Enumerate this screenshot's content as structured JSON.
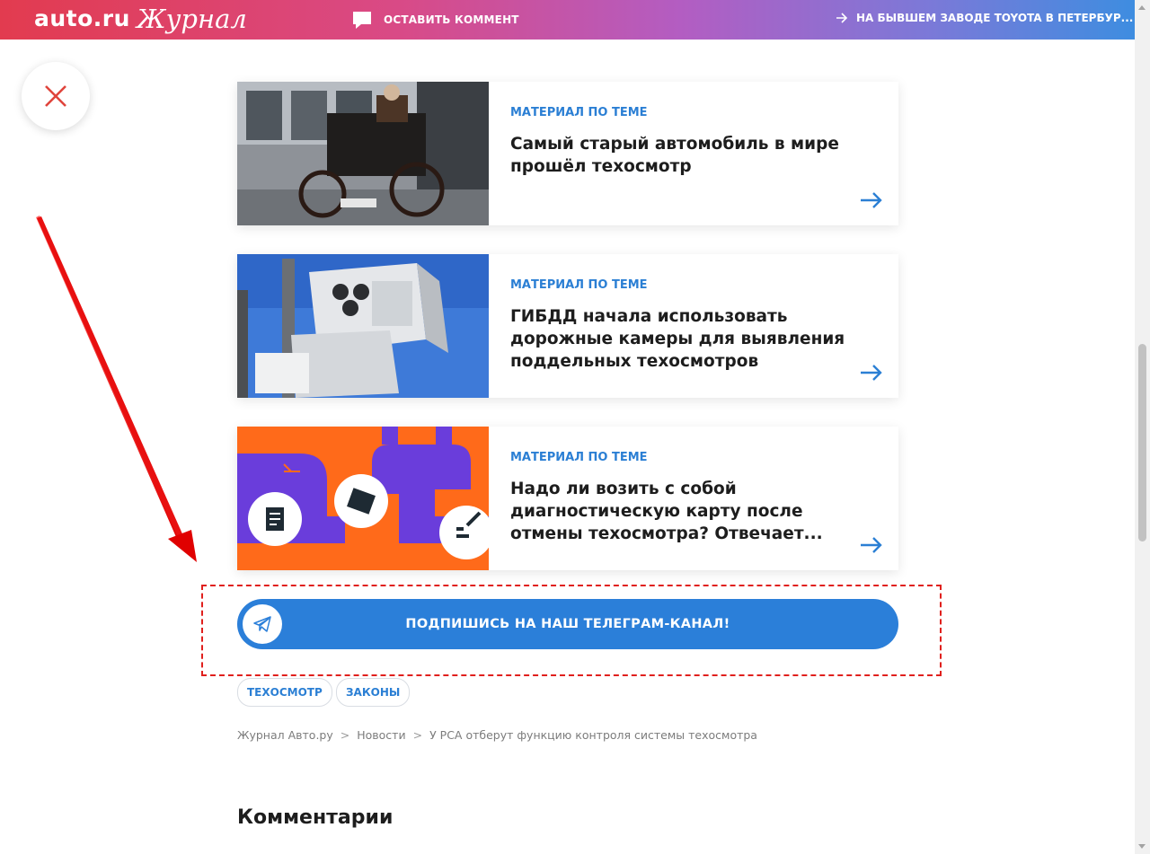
{
  "header": {
    "logo_auto": "auto.ru",
    "logo_journal": "Журнал",
    "comment_label": "ОСТАВИТЬ КОММЕНТ",
    "next_article": "НА БЫВШЕМ ЗАВОДЕ TOYOTA В ПЕТЕРБУР..."
  },
  "related": [
    {
      "kicker": "МАТЕРИАЛ ПО ТЕМЕ",
      "title": "Самый старый автомобиль в мире прошёл техосмотр"
    },
    {
      "kicker": "МАТЕРИАЛ ПО ТЕМЕ",
      "title": "ГИБДД начала использовать дорожные камеры для выявления поддельных техосмотров"
    },
    {
      "kicker": "МАТЕРИАЛ ПО ТЕМЕ",
      "title": "Надо ли возить с собой диагностическую карту после отмены техосмотра? Отвечает..."
    }
  ],
  "telegram": {
    "label": "ПОДПИШИСЬ НА НАШ ТЕЛЕГРАМ-КАНАЛ!"
  },
  "tags": [
    "ТЕХОСМОТР",
    "ЗАКОНЫ"
  ],
  "breadcrumb": {
    "items": [
      "Журнал Авто.ру",
      "Новости",
      "У РСА отберут функцию контроля системы техосмотра"
    ],
    "separator": ">"
  },
  "comments_heading": "Комментарии",
  "colors": {
    "accent": "#2b7fd9",
    "annotation_red": "#e0201d",
    "close_x": "#e0443c"
  }
}
